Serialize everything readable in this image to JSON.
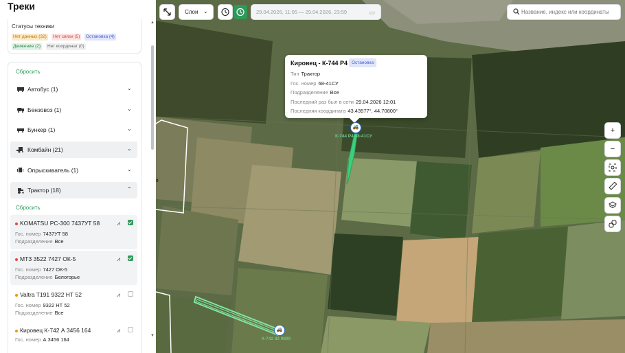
{
  "sidebar": {
    "title": "Треки",
    "status_title": "Статусы техники",
    "badges": {
      "no_data": "Нет данных (32)",
      "no_link": "Нет связи (5)",
      "stop": "Остановка (4)",
      "move": "Движение (2)",
      "no_coord": "Нет координат (0)"
    },
    "reset_label": "Сбросить",
    "categories": [
      {
        "label": "Автобус (1)",
        "icon": "bus-icon"
      },
      {
        "label": "Бензовоз (1)",
        "icon": "fuel-truck-icon"
      },
      {
        "label": "Бункер (1)",
        "icon": "bunker-icon"
      },
      {
        "label": "Комбайн (21)",
        "icon": "combine-icon"
      },
      {
        "label": "Опрыскиватель (1)",
        "icon": "sprayer-icon"
      },
      {
        "label": "Трактор (18)",
        "icon": "tractor-icon"
      }
    ],
    "vehicles": [
      {
        "name": "KOMATSU PC-300 7437УТ 58",
        "plate_key": "Гос. номер",
        "plate": "7437УТ 58",
        "div_key": "Подразделение",
        "division": "Все",
        "status_color": "#e04a3f",
        "checked": true
      },
      {
        "name": "МТЗ 3522 7427 ОК-5",
        "plate_key": "Гос. номер",
        "plate": "7427 ОК-5",
        "div_key": "Подразделение",
        "division": "Белогорье",
        "status_color": "#e04a3f",
        "checked": true
      },
      {
        "name": "Valtra T191 9322 НТ 52",
        "plate_key": "Гос. номер",
        "plate": "9322 НТ 52",
        "div_key": "Подразделение",
        "division": "Все",
        "status_color": "#e39a1e",
        "checked": false
      },
      {
        "name": "Кировец К-742 А 3456 164",
        "plate_key": "Гос. номер",
        "plate": "А 3456 164",
        "div_key": "Подразделение",
        "division": "",
        "status_color": "#e39a1e",
        "checked": false
      }
    ]
  },
  "toolbar": {
    "layers_label": "Слои",
    "date_range": "29.04.2026, 11:05 — 29.04.2026, 23:59",
    "search_placeholder": "Название, индекс или координаты"
  },
  "popup": {
    "title": "Кировец - К-744 Р4",
    "status": "Остановка",
    "type_key": "Тип",
    "type": "Трактор",
    "plate_key": "Гос. номер",
    "plate": "68-41СУ",
    "div_key": "Подразделение",
    "division": "Все",
    "last_seen_key": "Последний раз был в сети",
    "last_seen": "29.04.2026 12:01",
    "last_coord_key": "Последняя координата",
    "last_coord": "43.43577°, 44.70800°"
  },
  "map_labels": {
    "marker1": "К-744 Р4 68-41СУ",
    "marker2": "К-742 82 9800",
    "edge_mark": "0"
  },
  "colors": {
    "accent": "#2e9a5a",
    "track": "#3fcf7c"
  }
}
